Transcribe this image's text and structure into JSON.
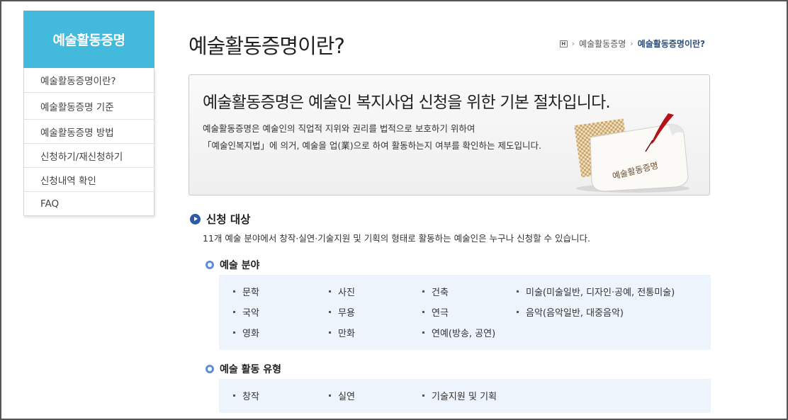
{
  "sidebar": {
    "title": "예술활동증명",
    "items": [
      {
        "label": "예술활동증명이란?"
      },
      {
        "label": "예술활동증명 기준"
      },
      {
        "label": "예술활동증명 방법"
      },
      {
        "label": "신청하기/재신청하기"
      },
      {
        "label": "신청내역 확인"
      },
      {
        "label": "FAQ"
      }
    ]
  },
  "header": {
    "title": "예술활동증명이란?",
    "breadcrumb": {
      "home_icon": "home-icon",
      "level1": "예술활동증명",
      "current": "예술활동증명이란?"
    }
  },
  "intro": {
    "heading": "예술활동증명은 예술인 복지사업 신청을 위한 기본 절차입니다.",
    "line1": "예술활동증명은 예술인의 직업적 지위와 권리를 법적으로 보호하기 위하여",
    "line2": "「예술인복지법」에 의거, 예술을 업(業)으로 하여 활동하는지 여부를 확인하는 제도입니다.",
    "illustration_text": "예술활동증명"
  },
  "target": {
    "title": "신청 대상",
    "description": "11개 예술 분야에서 창작·실연·기술지원 및 기획의 형태로 활동하는 예술인은 누구나 신청할 수 있습니다."
  },
  "fields": {
    "title": "예술 분야",
    "items": [
      "문학",
      "사진",
      "건축",
      "미술(미술일반, 디자인·공예, 전통미술)",
      "국악",
      "무용",
      "연극",
      "음악(음악일반, 대중음악)",
      "영화",
      "만화",
      "연예(방송, 공연)"
    ]
  },
  "activity_types": {
    "title": "예술 활동 유형",
    "items": [
      "창작",
      "실연",
      "기술지원 및 기획"
    ]
  },
  "colors": {
    "sidebar_header": "#43b9dc",
    "accent_blue": "#2e5aa8",
    "box_bg": "#eef4fb"
  }
}
